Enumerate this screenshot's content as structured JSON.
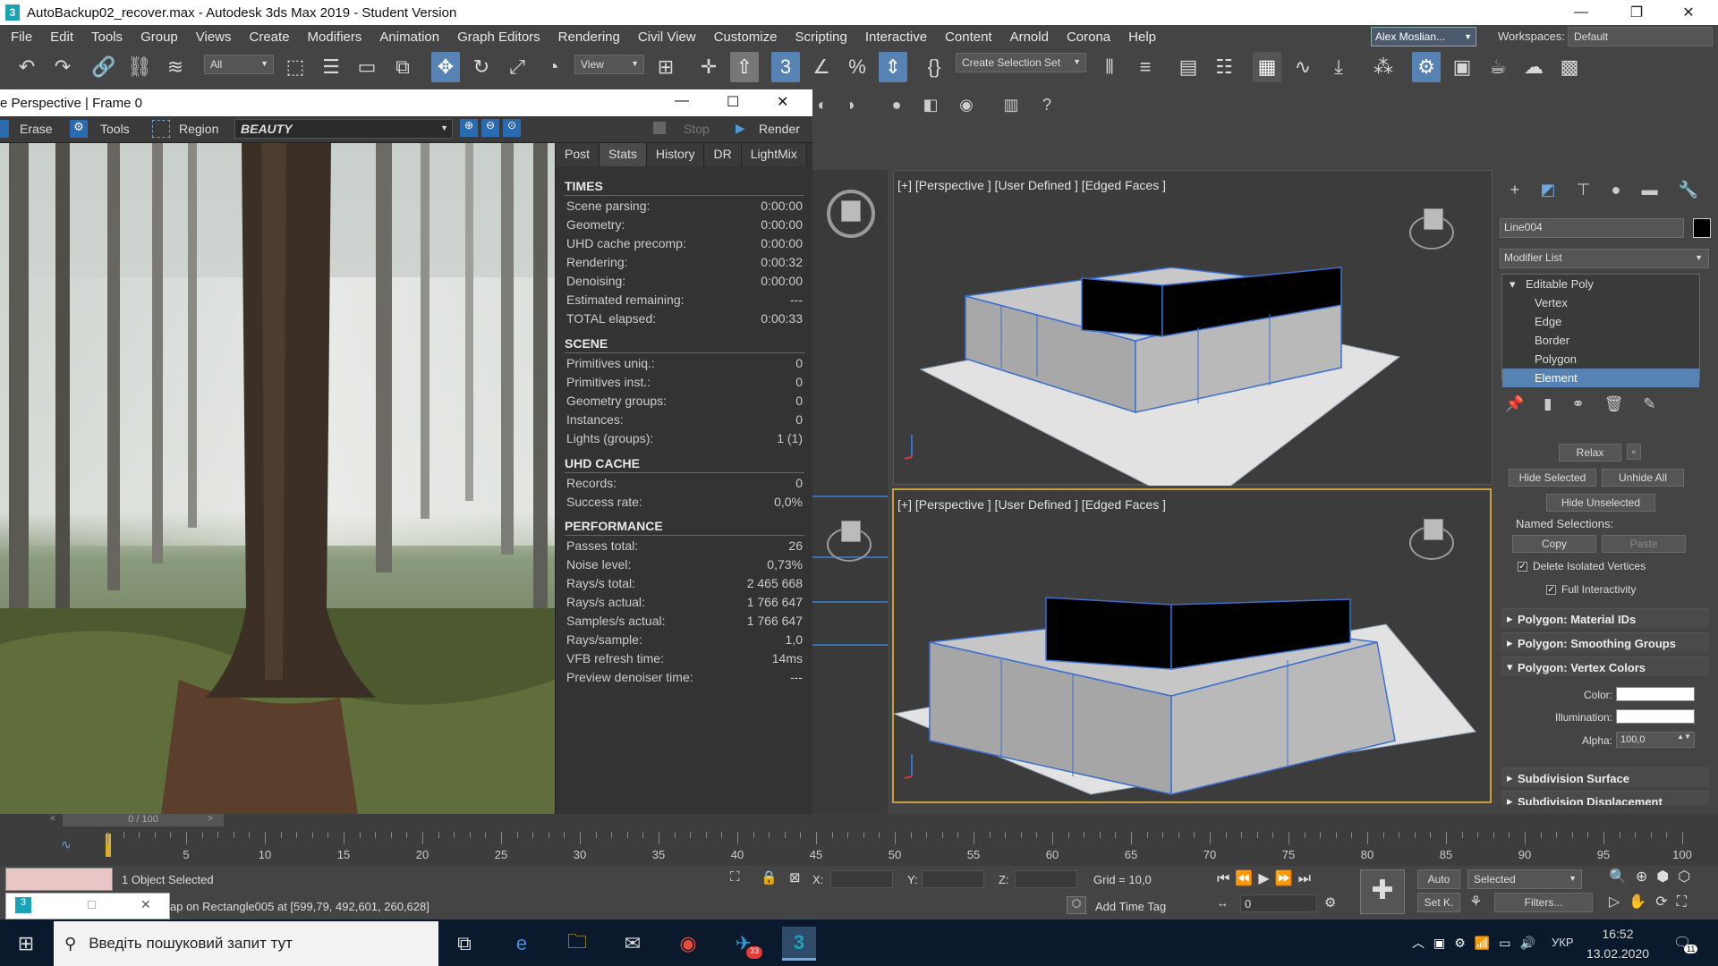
{
  "window": {
    "title": "AutoBackup02_recover.max - Autodesk 3ds Max 2019 - Student Version",
    "minimize": "—",
    "maximize": "❐",
    "close": "✕"
  },
  "menu": [
    "File",
    "Edit",
    "Tools",
    "Group",
    "Views",
    "Create",
    "Modifiers",
    "Animation",
    "Graph Editors",
    "Rendering",
    "Civil View",
    "Customize",
    "Scripting",
    "Interactive",
    "Content",
    "Arnold",
    "Corona",
    "Help"
  ],
  "user": "Alex Moslian...",
  "workspaces": {
    "label": "Workspaces:",
    "value": "Default"
  },
  "toolbar": {
    "filter": "All",
    "refcoord": "View",
    "selection_set": "Create Selection Set"
  },
  "vfb": {
    "title": "e Perspective | Frame 0",
    "erase": "Erase",
    "tools": "Tools",
    "region": "Region",
    "channel": "BEAUTY",
    "stop": "Stop",
    "render": "Render",
    "tabs": [
      "Post",
      "Stats",
      "History",
      "DR",
      "LightMix"
    ],
    "active_tab": "Stats"
  },
  "stats": {
    "times_title": "TIMES",
    "times": [
      {
        "k": "Scene parsing:",
        "v": "0:00:00"
      },
      {
        "k": "Geometry:",
        "v": "0:00:00"
      },
      {
        "k": "UHD cache precomp:",
        "v": "0:00:00"
      },
      {
        "k": "Rendering:",
        "v": "0:00:32"
      },
      {
        "k": "Denoising:",
        "v": "0:00:00"
      },
      {
        "k": "Estimated remaining:",
        "v": "---"
      },
      {
        "k": "TOTAL elapsed:",
        "v": "0:00:33"
      }
    ],
    "scene_title": "SCENE",
    "scene": [
      {
        "k": "Primitives uniq.:",
        "v": "0"
      },
      {
        "k": "Primitives inst.:",
        "v": "0"
      },
      {
        "k": "Geometry groups:",
        "v": "0"
      },
      {
        "k": "Instances:",
        "v": "0"
      },
      {
        "k": "Lights (groups):",
        "v": "1 (1)"
      }
    ],
    "uhd_title": "UHD CACHE",
    "uhd": [
      {
        "k": "Records:",
        "v": "0"
      },
      {
        "k": "Success rate:",
        "v": "0,0%"
      }
    ],
    "perf_title": "PERFORMANCE",
    "perf": [
      {
        "k": "Passes total:",
        "v": "26"
      },
      {
        "k": "Noise level:",
        "v": "0,73%"
      },
      {
        "k": "Rays/s total:",
        "v": "2 465 668"
      },
      {
        "k": "Rays/s actual:",
        "v": "1 766 647"
      },
      {
        "k": "Samples/s actual:",
        "v": "1 766 647"
      },
      {
        "k": "Rays/sample:",
        "v": "1,0"
      },
      {
        "k": "VFB refresh time:",
        "v": "14ms"
      },
      {
        "k": "Preview denoiser time:",
        "v": "---"
      }
    ]
  },
  "viewports": {
    "top_label": "[+] [Perspective ] [User Defined ] [Edged Faces ]",
    "bottom_label": "[+] [Perspective ] [User Defined ] [Edged Faces ]"
  },
  "cmdpanel": {
    "object_name": "Line004",
    "modifier_list": "Modifier List",
    "stack": [
      "Editable Poly",
      "Vertex",
      "Edge",
      "Border",
      "Polygon",
      "Element"
    ],
    "selected_stack": "Element",
    "relax": "Relax",
    "hide_selected": "Hide Selected",
    "unhide_all": "Unhide All",
    "hide_unselected": "Hide Unselected",
    "named_selections": "Named Selections:",
    "copy": "Copy",
    "paste": "Paste",
    "delete_isolated": "Delete Isolated Vertices",
    "full_interactivity": "Full Interactivity",
    "rollouts": [
      "Polygon: Material IDs",
      "Polygon: Smoothing Groups",
      "Polygon: Vertex Colors"
    ],
    "color_label": "Color:",
    "illum_label": "Illumination:",
    "alpha_label": "Alpha:",
    "alpha_value": "100,0",
    "subdiv": "Subdivision Surface",
    "subdiv_disp": "Subdivision Displacement"
  },
  "timeline": {
    "slider": "0 / 100",
    "ticks": [
      5,
      10,
      15,
      20,
      25,
      30,
      35,
      40,
      45,
      50,
      55,
      60,
      65,
      70,
      75,
      80,
      85,
      90,
      95,
      100
    ]
  },
  "status": {
    "selected": "1 Object Selected",
    "prompt": "ap on Rectangle005 at [599,79, 492,601, 260,628]",
    "x": "X:",
    "y": "Y:",
    "z": "Z:",
    "grid": "Grid = 10,0",
    "add_time_tag": "Add Time Tag",
    "auto": "Auto",
    "selected_dd": "Selected",
    "setk": "Set K.",
    "filters": "Filters...",
    "frame": "0"
  },
  "taskbar": {
    "search": "Введіть пошуковий запит тут",
    "time": "16:52",
    "date": "13.02.2020",
    "lang": "УКР",
    "notif": "11",
    "telegram_badge": "33"
  },
  "colors": {
    "accent": "#5683b3",
    "active_border": "#c8a13e"
  }
}
